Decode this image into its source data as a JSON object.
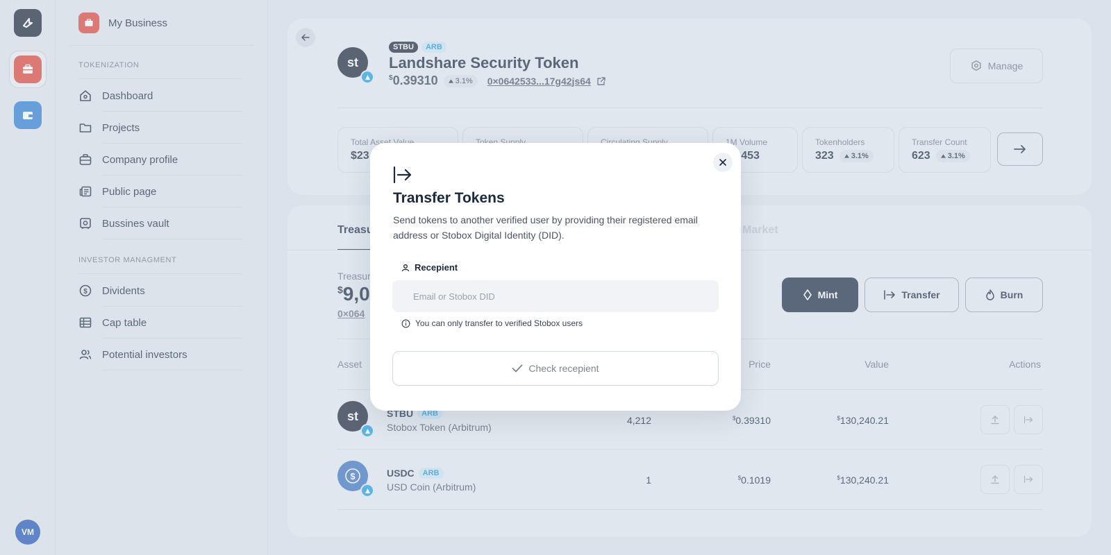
{
  "rail": {
    "avatar_initials": "VM"
  },
  "sidebar": {
    "business_name": "My Business",
    "sections": [
      {
        "label": "TOKENIZATION",
        "items": [
          "Dashboard",
          "Projects",
          "Company profile",
          "Public page",
          "Bussines vault"
        ]
      },
      {
        "label": "INVESTOR MANAGMENT",
        "items": [
          "Dividents",
          "Cap table",
          "Potential investors"
        ]
      }
    ]
  },
  "token": {
    "symbol": "STBU",
    "chain": "ARB",
    "avatar_text": "st",
    "name": "Landshare Security Token",
    "price_currency": "$",
    "price": "0.39310",
    "change": "3.1%",
    "address": "0×0642533...17g42js64",
    "manage_label": "Manage"
  },
  "stats": [
    {
      "label": "Total Asset Value",
      "value": "$23"
    },
    {
      "label": "Token Supply",
      "value": ""
    },
    {
      "label": "Circulating Supply",
      "value": ""
    },
    {
      "label": "1M Volume",
      "value": "43,453"
    },
    {
      "label": "Tokenholders",
      "value": "323",
      "change": "3.1%"
    },
    {
      "label": "Transfer Count",
      "value": "623",
      "change": "3.1%"
    }
  ],
  "tabs": {
    "active": "Treasu",
    "inactive": "Market"
  },
  "treasury": {
    "label": "Treasur",
    "currency": "$",
    "value": "9,0",
    "address": "0×064"
  },
  "actions": {
    "mint": "Mint",
    "transfer": "Transfer",
    "burn": "Burn"
  },
  "table": {
    "headers": {
      "asset": "Asset",
      "price": "Price",
      "value": "Value",
      "actions": "Actions"
    },
    "rows": [
      {
        "symbol": "STBU",
        "chain": "ARB",
        "name": "Stobox Token (Arbitrum)",
        "amount": "4,212",
        "price": "0.39310",
        "value": "130,240.21",
        "avatar_text": "st"
      },
      {
        "symbol": "USDC",
        "chain": "ARB",
        "name": "USD Coin (Arbitrum)",
        "amount": "1",
        "price": "0.1019",
        "value": "130,240.21",
        "avatar_text": "$"
      }
    ]
  },
  "modal": {
    "title": "Transfer Tokens",
    "description": "Send tokens to another verified user by providing their registered email address or Stobox Digital Identity (DID).",
    "recipient_label": "Recepient",
    "input_placeholder": "Email or Stobox DID",
    "input_value": "",
    "hint": "You can only transfer to verified Stobox users",
    "check_label": "Check recepient"
  }
}
